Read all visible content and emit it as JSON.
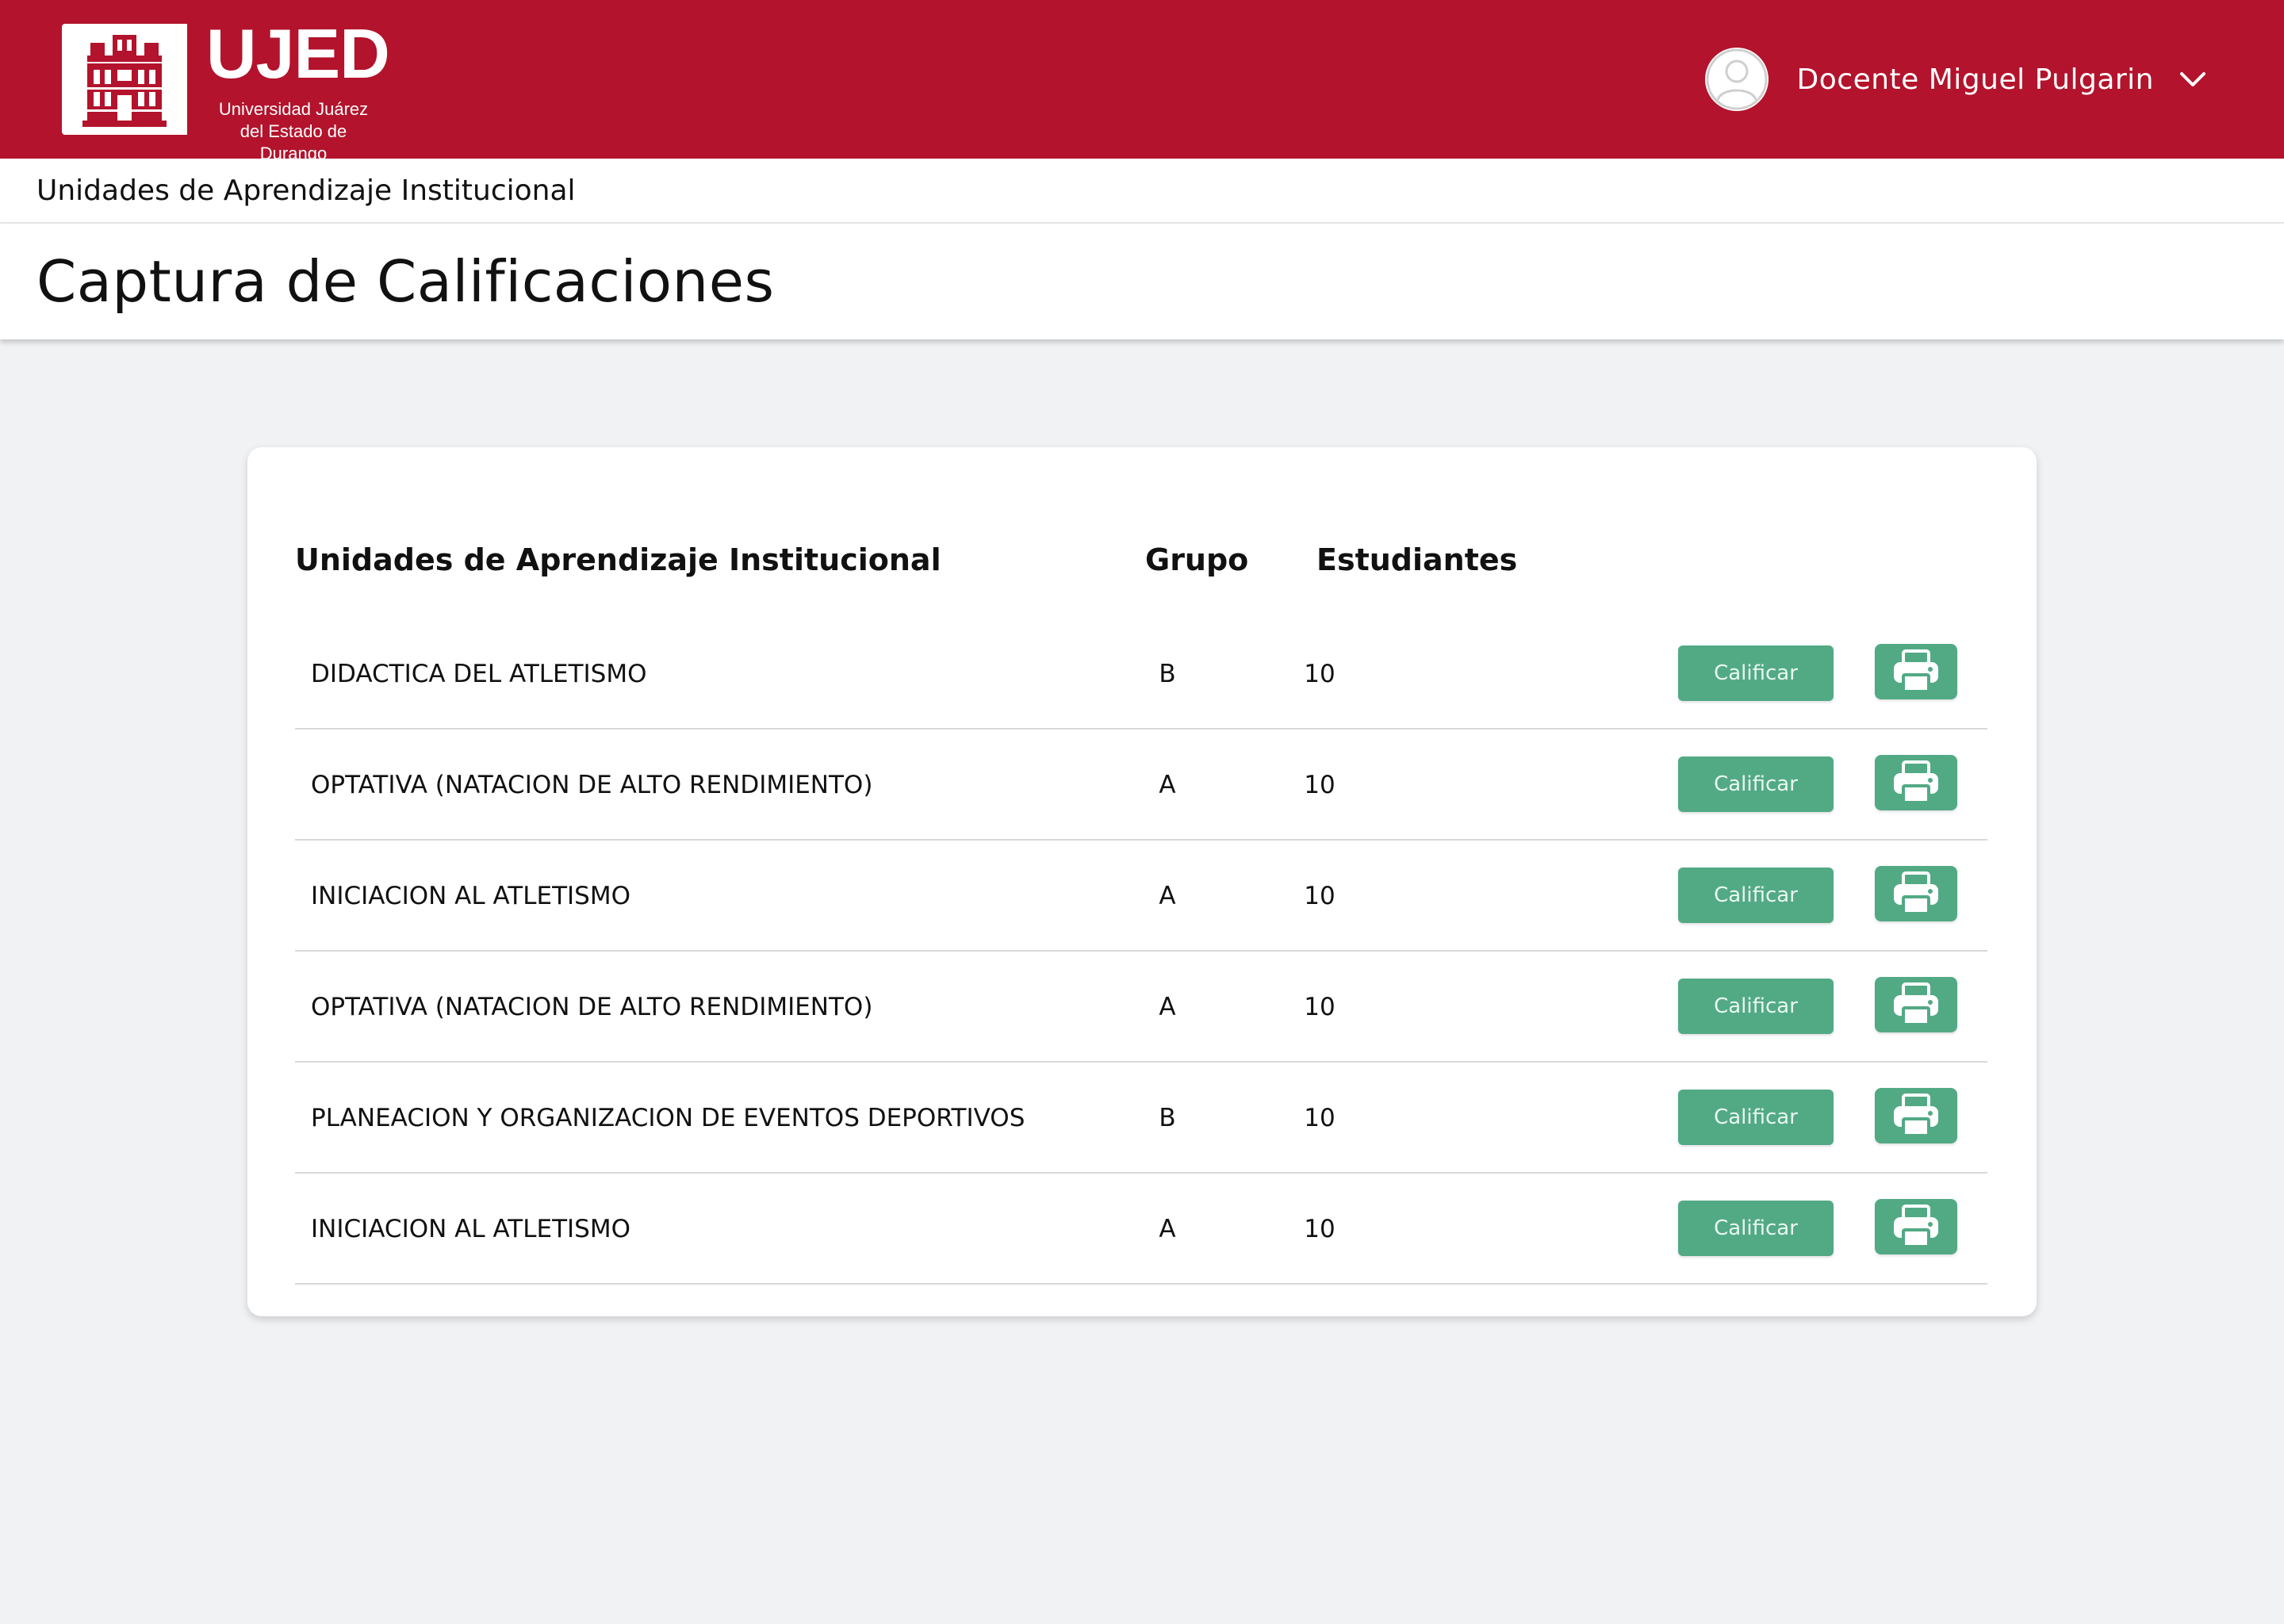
{
  "header": {
    "logo_title": "UJED",
    "logo_subtitle_line1": "Universidad Juárez",
    "logo_subtitle_line2": "del Estado de Durango",
    "user_name": "Docente Miguel Pulgarin",
    "brand_color": "#b3132c"
  },
  "breadcrumb": "Unidades de Aprendizaje Institucional",
  "page_title": "Captura de Calificaciones",
  "table": {
    "headers": {
      "subject": "Unidades de Aprendizaje Institucional",
      "group": "Grupo",
      "students": "Estudiantes"
    },
    "rows": [
      {
        "subject": "DIDACTICA DEL ATLETISMO",
        "group": "B",
        "students": "10",
        "action": "Calificar"
      },
      {
        "subject": "OPTATIVA (NATACION DE ALTO RENDIMIENTO)",
        "group": "A",
        "students": "10",
        "action": "Calificar"
      },
      {
        "subject": "INICIACION AL ATLETISMO",
        "group": "A",
        "students": "10",
        "action": "Calificar"
      },
      {
        "subject": "OPTATIVA (NATACION DE ALTO RENDIMIENTO)",
        "group": "A",
        "students": "10",
        "action": "Calificar"
      },
      {
        "subject": "PLANEACION Y ORGANIZACION DE EVENTOS DEPORTIVOS",
        "group": "B",
        "students": "10",
        "action": "Calificar"
      },
      {
        "subject": "INICIACION AL ATLETISMO",
        "group": "A",
        "students": "10",
        "action": "Calificar"
      }
    ]
  },
  "icons": {
    "avatar": "user-avatar-icon",
    "dropdown": "chevron-down-icon",
    "print": "printer-icon"
  },
  "accent_color": "#52aa85"
}
